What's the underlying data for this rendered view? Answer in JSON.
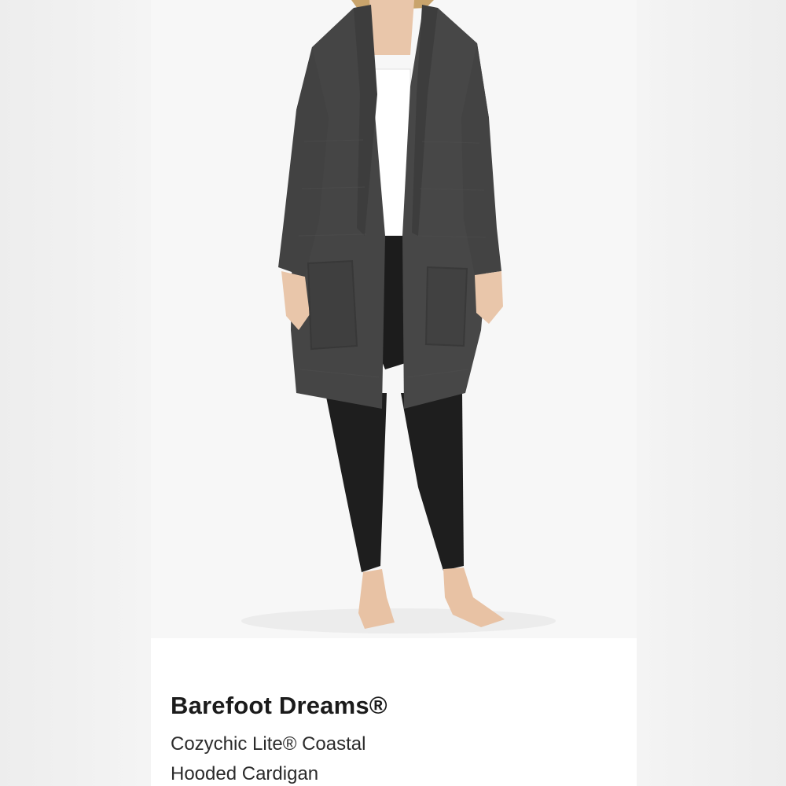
{
  "product": {
    "brand": "Barefoot Dreams®",
    "name_lines": [
      "Cozychic Lite® Coastal",
      "Hooded Cardigan"
    ]
  },
  "colors": {
    "background": "#f4f4f4",
    "card": "#ffffff",
    "cardigan": "#444444",
    "leggings": "#1c1c1c",
    "tank": "#ffffff",
    "skin": "#e8c4a8",
    "text": "#1b1b1b"
  },
  "icons": {
    "photo": "product-photo-model-in-cardigan"
  }
}
